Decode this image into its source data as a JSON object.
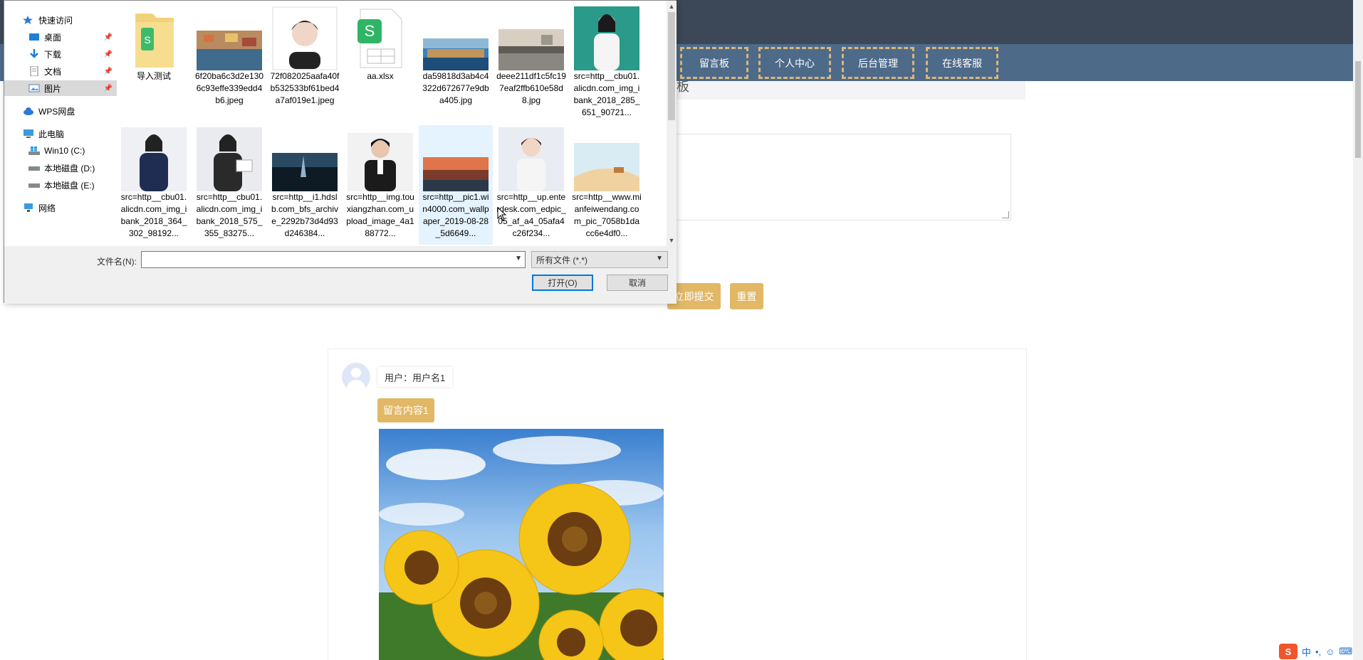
{
  "nav": {
    "items": [
      "留言板",
      "个人中心",
      "后台管理",
      "在线客服"
    ]
  },
  "board": {
    "title": "板"
  },
  "form": {
    "submit_label": "立即提交",
    "reset_label": "重置"
  },
  "message": {
    "user": "用户：用户名1",
    "content": "留言内容1"
  },
  "dialog": {
    "sidebar": {
      "quick_access": "快速访问",
      "desktop": "桌面",
      "downloads": "下载",
      "documents": "文档",
      "pictures": "图片",
      "wps": "WPS网盘",
      "this_pc": "此电脑",
      "drive_c": "Win10 (C:)",
      "drive_d": "本地磁盘 (D:)",
      "drive_e": "本地磁盘 (E:)",
      "network": "网络"
    },
    "files": [
      {
        "name": "导入测试",
        "icon": "folder-icon"
      },
      {
        "name": "6f20ba6c3d2e1306c93effe339edd4b6.jpeg",
        "icon": "landscape-thumb"
      },
      {
        "name": "72f082025aafa40fb532533bf61bed4a7af019e1.jpeg",
        "icon": "portrait-thumb"
      },
      {
        "name": "aa.xlsx",
        "icon": "spreadsheet-icon"
      },
      {
        "name": "da59818d3ab4c4322d672677e9dba405.jpg",
        "icon": "harbor-thumb"
      },
      {
        "name": "deee211df1c5fc197eaf2ffb610e58d8.jpg",
        "icon": "sunset-thumb"
      },
      {
        "name": "src=http__cbu01.alicdn.com_img_ibank_2018_285_651_90721...",
        "icon": "woman-thumb"
      },
      {
        "name": "src=http__cbu01.alicdn.com_img_ibank_2018_364_302_98192...",
        "icon": "woman-thumb"
      },
      {
        "name": "src=http__cbu01.alicdn.com_img_ibank_2018_575_355_83275...",
        "icon": "woman-thumb"
      },
      {
        "name": "src=http__i1.hdslb.com_bfs_archive_2292b73d4d93d246384...",
        "icon": "dark-thumb"
      },
      {
        "name": "src=http__img.touxiangzhan.com_upload_image_4a188772...",
        "icon": "man-thumb"
      },
      {
        "name": "src=http__pic1.win4000.com_wallpaper_2019-08-28_5d6649...",
        "icon": "sky-thumb"
      },
      {
        "name": "src=http__up.enterdesk.com_edpic_05_af_a4_05afa4c26f234...",
        "icon": "man-thumb"
      },
      {
        "name": "src=http__www.mianfeiwendang.com_pic_7058b1dacc6e4df0...",
        "icon": "desert-thumb"
      }
    ],
    "filename_label": "文件名(N):",
    "filename_value": "",
    "filter_label": "所有文件 (*.*)",
    "open_label": "打开(O)",
    "cancel_label": "取消"
  },
  "tray": {
    "ime": "中",
    "punct": "•,"
  }
}
